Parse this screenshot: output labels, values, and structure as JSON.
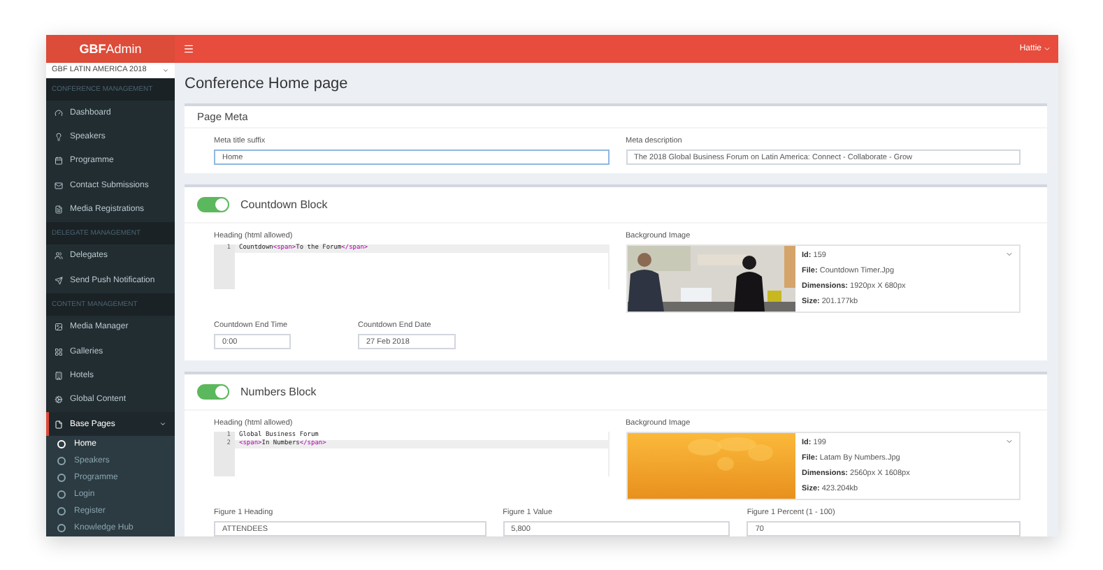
{
  "brand": "**GBF**Admin",
  "header": {
    "user": "Hattie"
  },
  "sidebar": {
    "site_select": "GBF LATIN AMERICA 2018",
    "items": [
      {
        "kind": "section",
        "label": "CONFERENCE MANAGEMENT"
      },
      {
        "kind": "link",
        "label": "Dashboard",
        "selected": false
      },
      {
        "kind": "link",
        "label": "Speakers",
        "selected": false
      },
      {
        "kind": "link",
        "label": "Programme",
        "selected": false
      },
      {
        "kind": "link",
        "label": "Contact Submissions",
        "selected": false
      },
      {
        "kind": "link",
        "label": "Media Registrations",
        "selected": false
      },
      {
        "kind": "section",
        "label": "DELEGATE MANAGEMENT"
      },
      {
        "kind": "link",
        "label": "Delegates",
        "selected": false
      },
      {
        "kind": "link",
        "label": "Send Push Notification",
        "selected": false
      },
      {
        "kind": "section",
        "label": "CONTENT MANAGEMENT"
      },
      {
        "kind": "link",
        "label": "Media Manager",
        "selected": false
      },
      {
        "kind": "link",
        "label": "Galleries",
        "selected": false
      },
      {
        "kind": "link",
        "label": "Hotels",
        "selected": false
      },
      {
        "kind": "link",
        "label": "Global Content",
        "selected": false
      },
      {
        "kind": "link",
        "label": "Base Pages",
        "selected": true,
        "expanded": true,
        "children": [
          {
            "label": "Home",
            "selected": true
          },
          {
            "label": "Speakers",
            "selected": false
          },
          {
            "label": "Programme",
            "selected": false
          },
          {
            "label": "Login",
            "selected": false
          },
          {
            "label": "Register",
            "selected": false
          },
          {
            "label": "Knowledge Hub",
            "selected": false
          }
        ]
      }
    ]
  },
  "page_title": "Conference Home page",
  "page_meta": {
    "title": "Page Meta",
    "fields": [
      {
        "label": "Meta title suffix",
        "value": "Home",
        "focused": true
      },
      {
        "label": "Meta description",
        "value": "The 2018 Global Business Forum on Latin America: Connect - Collaborate - Grow",
        "focused": false
      }
    ]
  },
  "blocks": [
    {
      "kind": "countdown",
      "title": "Countdown Block",
      "on": true,
      "heading_label": "Heading (html allowed)",
      "lines": [
        {
          "number": "1",
          "text": "Countdown<span>To the Forum</span>",
          "active": true
        }
      ],
      "image_label": "Background Image",
      "image": {
        "id": "**Id:** 159",
        "file": "**File:** Countdown Timer.Jpg",
        "dimensions": "**Dimensions:** 1920px X 680px",
        "size": "**Size:** 201.177kb"
      },
      "fields": [
        {
          "label": "Countdown End Time",
          "value": "0:00"
        },
        {
          "label": "Countdown End Date",
          "value": "27 Feb 2018"
        }
      ]
    },
    {
      "kind": "numbers",
      "title": "Numbers Block",
      "on": true,
      "heading_label": "Heading (html allowed)",
      "lines": [
        {
          "number": "1",
          "text": "Global Business Forum",
          "active": false
        },
        {
          "number": "2",
          "text": "<span>In Numbers</span>",
          "active": true
        }
      ],
      "image_label": "Background Image",
      "image": {
        "id": "**Id:** 199",
        "file": "**File:** Latam By Numbers.Jpg",
        "dimensions": "**Dimensions:** 2560px X 1608px",
        "size": "**Size:** 423.204kb"
      },
      "fields": [
        {
          "label": "Figure 1 Heading",
          "value": "ATTENDEES"
        },
        {
          "label": "Figure 1 Value",
          "value": "5,800"
        },
        {
          "label": "Figure 1 Percent (1 - 100)",
          "value": "70"
        }
      ]
    }
  ]
}
